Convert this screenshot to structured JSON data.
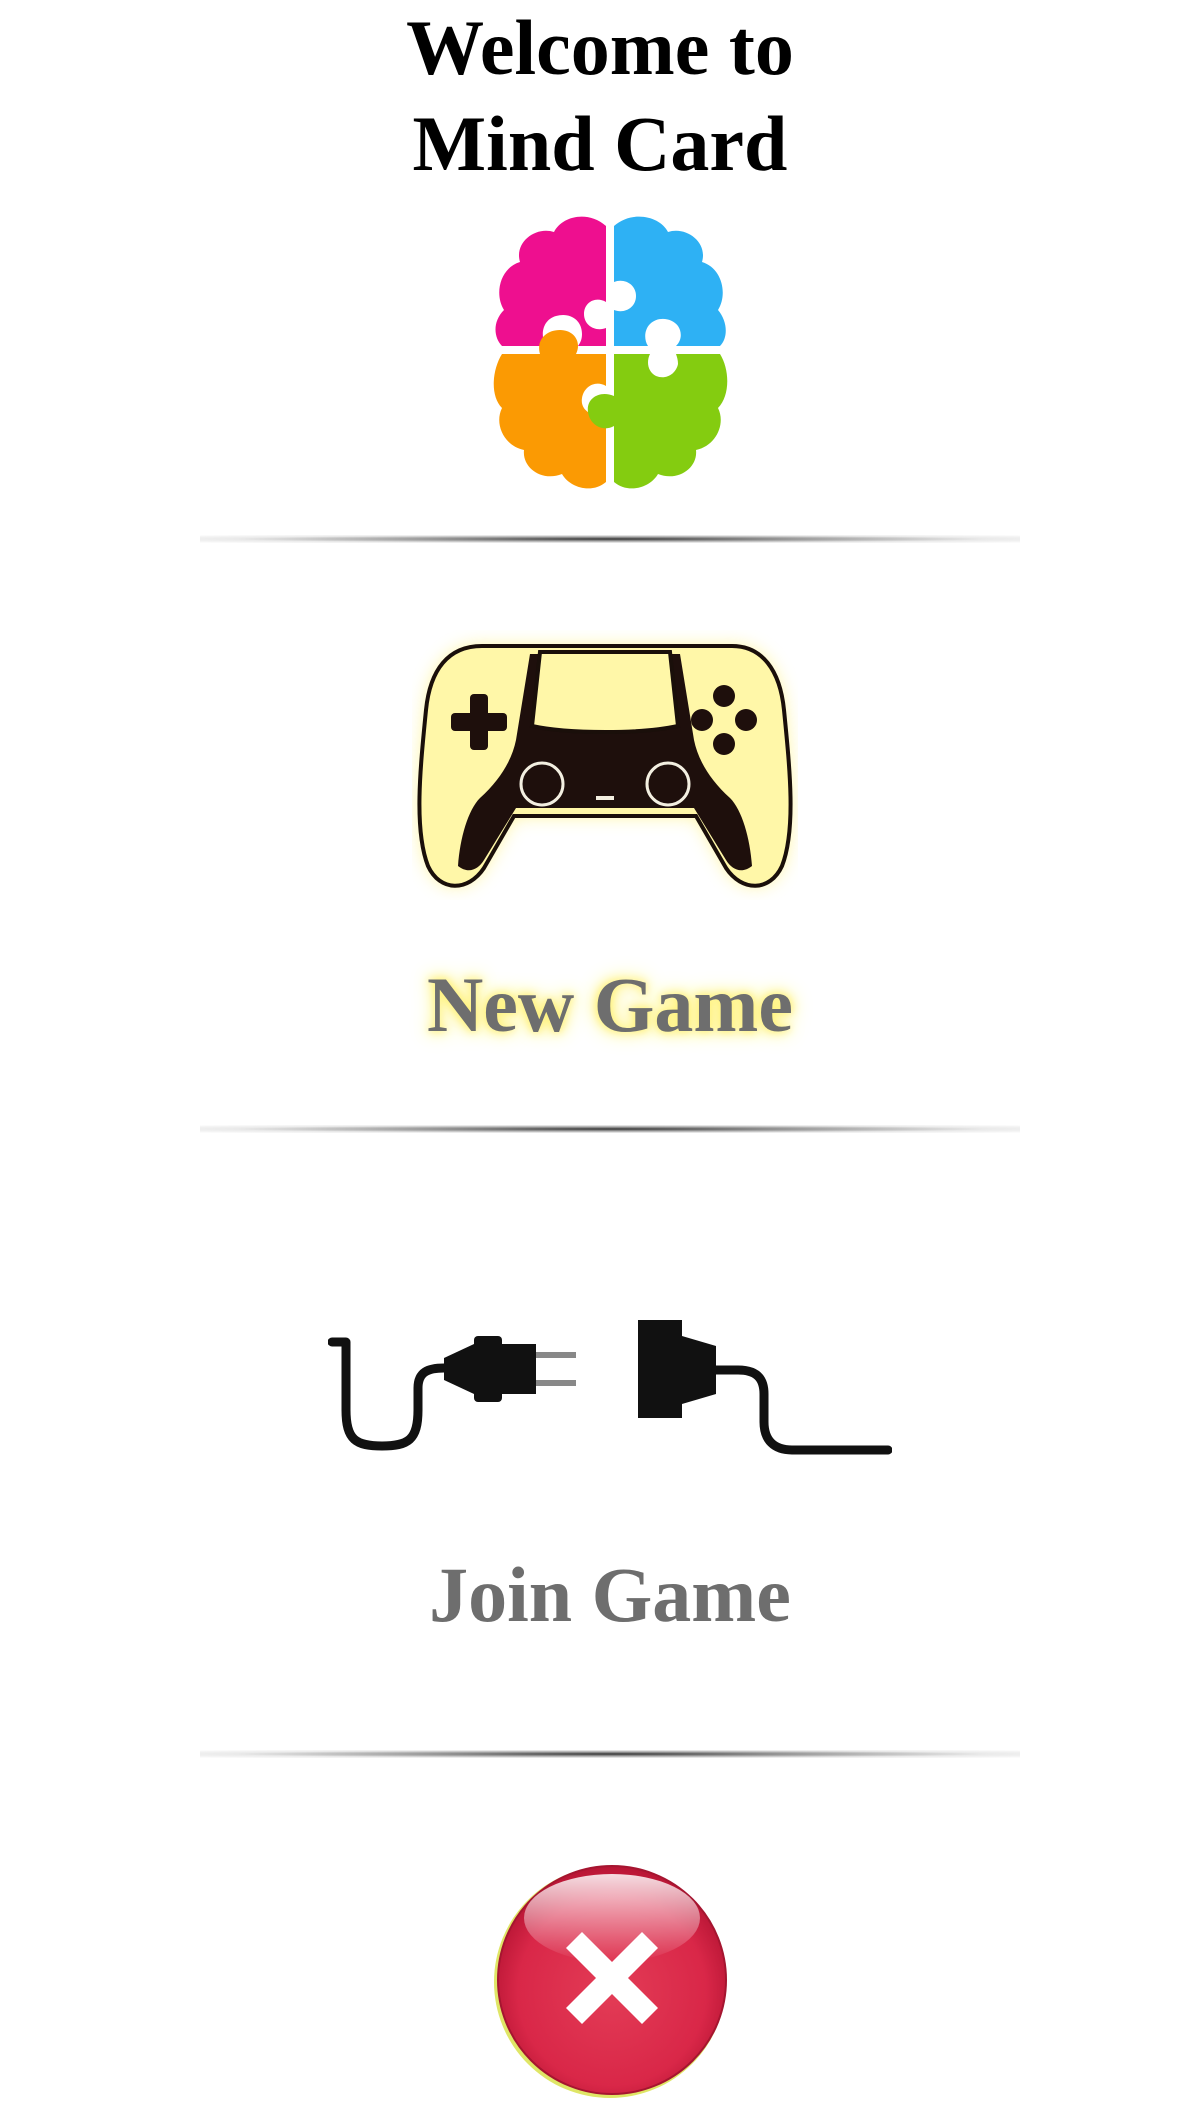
{
  "header": {
    "title_line1": "Welcome to",
    "title_line2": "Mind Card"
  },
  "logo": {
    "icon": "brain-puzzle-icon",
    "colors": {
      "top_left": "#ee0f8f",
      "top_right": "#2eb1f4",
      "bottom_left": "#fb9a03",
      "bottom_right": "#84cc10"
    }
  },
  "menu": {
    "new_game": {
      "label": "New Game",
      "icon": "gamepad-icon",
      "glow_color": "#fff27a"
    },
    "join_game": {
      "label": "Join Game",
      "icon": "plug-connection-icon"
    },
    "exit": {
      "icon": "close-icon",
      "color": "#e0334f"
    }
  }
}
